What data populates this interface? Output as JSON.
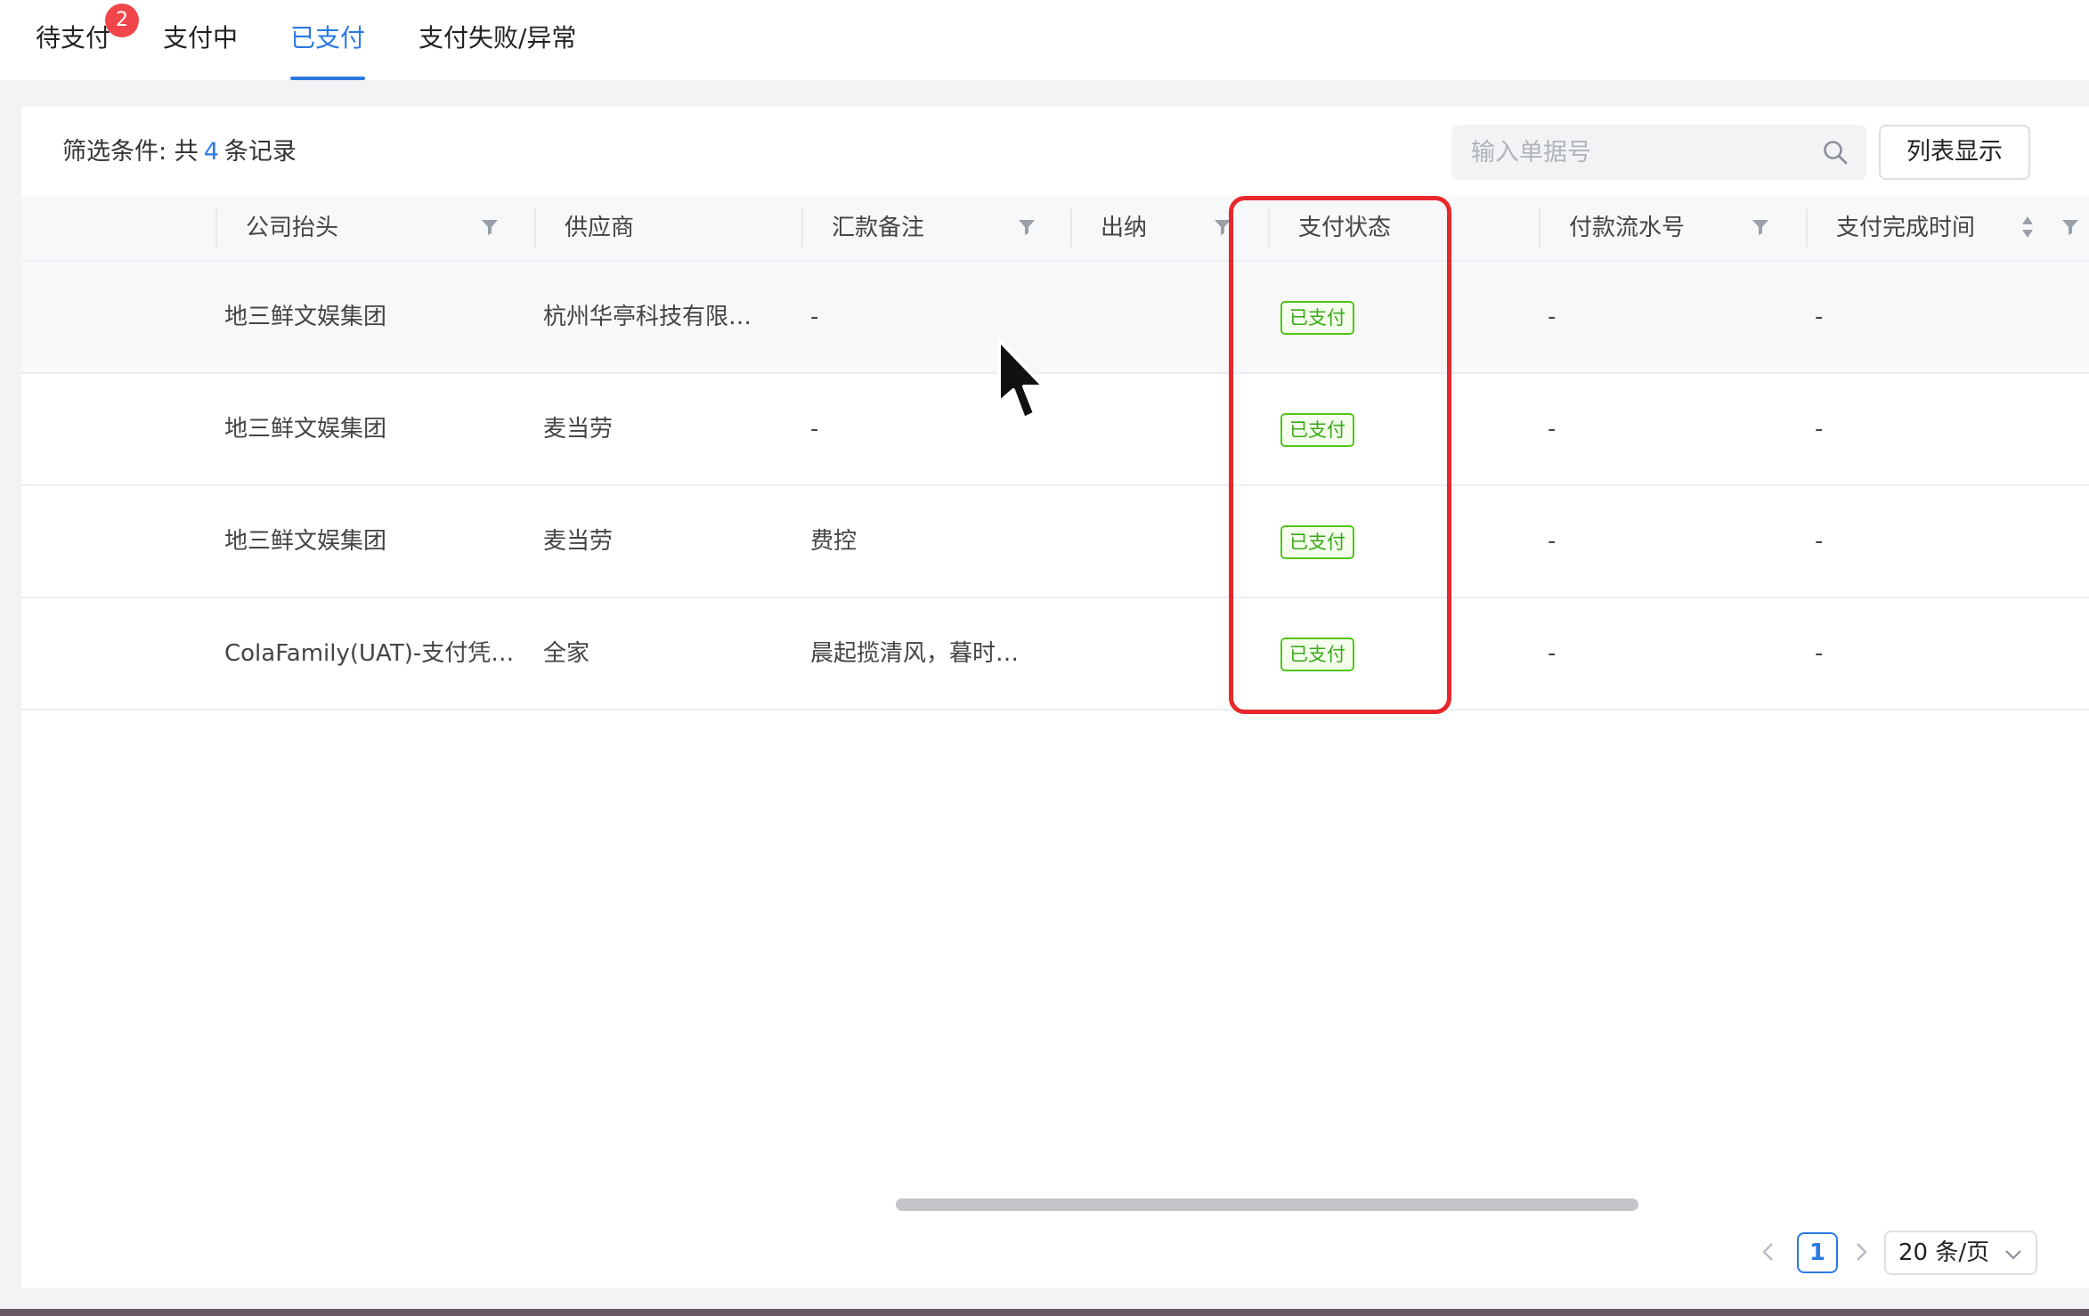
{
  "tabs": [
    {
      "label": "待支付",
      "badge": "2"
    },
    {
      "label": "支付中"
    },
    {
      "label": "已支付"
    },
    {
      "label": "支付失败/异常"
    }
  ],
  "toolbar": {
    "filter_prefix": "筛选条件:  共",
    "record_count": "4",
    "filter_suffix": "条记录",
    "search_placeholder": "输入单据号",
    "list_display_label": "列表显示"
  },
  "table": {
    "columns": [
      "公司抬头",
      "供应商",
      "汇款备注",
      "出纳",
      "支付状态",
      "付款流水号",
      "支付完成时间"
    ],
    "rows": [
      {
        "company": "地三鲜文娱集团",
        "supplier": "杭州华亭科技有限…",
        "remark": "-",
        "cashier": "",
        "status": "已支付",
        "serial": "-",
        "completed_at": "-"
      },
      {
        "company": "地三鲜文娱集团",
        "supplier": "麦当劳",
        "remark": "-",
        "cashier": "",
        "status": "已支付",
        "serial": "-",
        "completed_at": "-"
      },
      {
        "company": "地三鲜文娱集团",
        "supplier": "麦当劳",
        "remark": "费控",
        "cashier": "",
        "status": "已支付",
        "serial": "-",
        "completed_at": "-"
      },
      {
        "company": "ColaFamily(UAT)-支付凭…",
        "supplier": "全家",
        "remark": "晨起揽清风，暮时…",
        "cashier": "",
        "status": "已支付",
        "serial": "-",
        "completed_at": "-"
      }
    ]
  },
  "pagination": {
    "current_page": "1",
    "page_size": "20 条/页"
  },
  "colors": {
    "accent": "#2a7ae2",
    "badge": "#f0464b",
    "status_paid": "#38a816",
    "highlight": "#e8282b"
  },
  "icons": [
    "search-icon",
    "filter-icon",
    "sort-icon",
    "chevron-left-icon",
    "chevron-right-icon",
    "chevron-down-icon",
    "mouse-cursor-icon"
  ]
}
